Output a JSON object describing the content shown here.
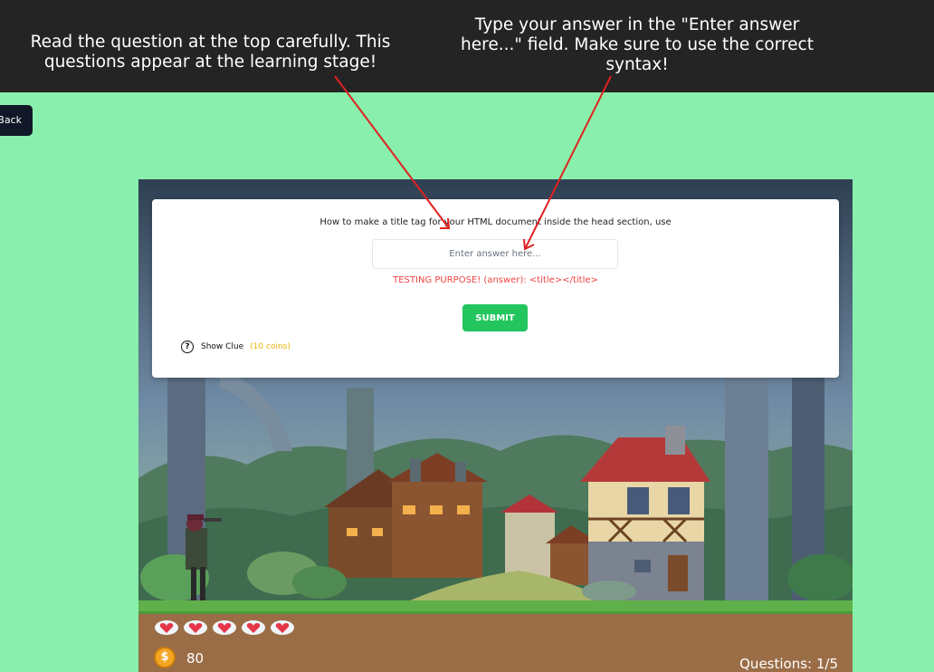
{
  "annotations": {
    "left": "Read the question at the top carefully. This questions appear at the learning stage!",
    "right": "Type your answer in the \"Enter answer here...\" field.  Make sure to use the correct syntax!"
  },
  "back_label": "Back",
  "question_card": {
    "question": "How to make a title tag for your HTML document inside the head section, use",
    "answer_placeholder": "Enter answer here...",
    "testing_text": "TESTING PURPOSE! (answer): <title></title>",
    "submit_label": "SUBMIT",
    "clue_icon": "?",
    "clue_label": "Show Clue",
    "clue_cost": "(10 coins)"
  },
  "hud": {
    "hearts": 5,
    "coin_icon": "$",
    "coins": "80",
    "questions": "Questions: 1/5"
  },
  "colors": {
    "background": "#88efac",
    "submit": "#22c55e",
    "testing": "#ef4444",
    "clue_cost": "#eab308",
    "annotation_arrow": "#e02020"
  }
}
